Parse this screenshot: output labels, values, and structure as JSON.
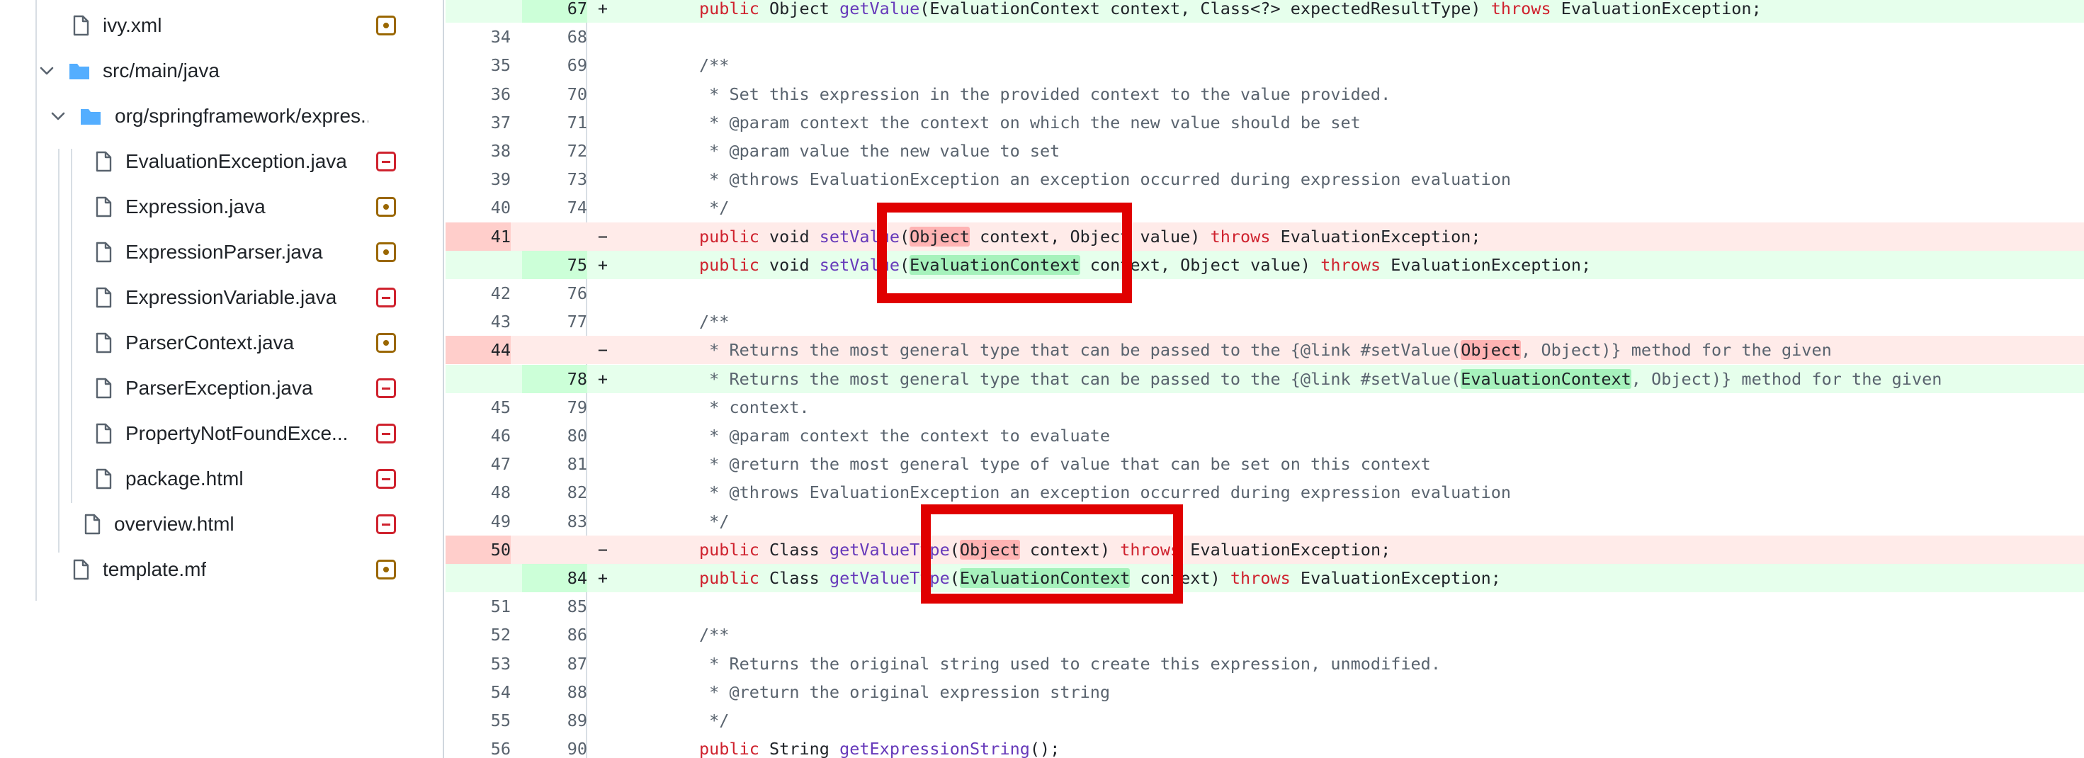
{
  "file_tree": {
    "items": [
      {
        "name": "ivy.xml",
        "status": "modified",
        "kind": "file"
      },
      {
        "name": "src/main/java",
        "kind": "folder"
      },
      {
        "name": "org/springframework/expres...",
        "kind": "folder"
      },
      {
        "name": "EvaluationException.java",
        "status": "deleted",
        "kind": "file"
      },
      {
        "name": "Expression.java",
        "status": "modified",
        "kind": "file"
      },
      {
        "name": "ExpressionParser.java",
        "status": "modified",
        "kind": "file"
      },
      {
        "name": "ExpressionVariable.java",
        "status": "deleted",
        "kind": "file"
      },
      {
        "name": "ParserContext.java",
        "status": "modified",
        "kind": "file"
      },
      {
        "name": "ParserException.java",
        "status": "deleted",
        "kind": "file"
      },
      {
        "name": "PropertyNotFoundExce...",
        "status": "deleted",
        "kind": "file"
      },
      {
        "name": "package.html",
        "status": "deleted",
        "kind": "file"
      },
      {
        "name": "overview.html",
        "status": "deleted",
        "kind": "file"
      },
      {
        "name": "template.mf",
        "status": "modified",
        "kind": "file"
      }
    ]
  },
  "diff": {
    "rows": [
      {
        "old": "",
        "new": "67",
        "type": "add",
        "sign": "+",
        "tokens": [
          [
            "kw",
            "public"
          ],
          [
            "t",
            " Object "
          ],
          [
            "fn",
            "getValue"
          ],
          [
            "t",
            "(EvaluationContext context, Class<?> expectedResultType) "
          ],
          [
            "kw",
            "throws"
          ],
          [
            "t",
            " EvaluationException;"
          ]
        ]
      },
      {
        "old": "34",
        "new": "68",
        "type": "ctx",
        "sign": "",
        "tokens": []
      },
      {
        "old": "35",
        "new": "69",
        "type": "ctx",
        "sign": "",
        "tokens": [
          [
            "cm",
            "/**"
          ]
        ]
      },
      {
        "old": "36",
        "new": "70",
        "type": "ctx",
        "sign": "",
        "tokens": [
          [
            "cm",
            " * Set this expression in the provided context to the value provided."
          ]
        ]
      },
      {
        "old": "37",
        "new": "71",
        "type": "ctx",
        "sign": "",
        "tokens": [
          [
            "cm",
            " * @param context the context on which the new value should be set"
          ]
        ]
      },
      {
        "old": "38",
        "new": "72",
        "type": "ctx",
        "sign": "",
        "tokens": [
          [
            "cm",
            " * @param value the new value to set"
          ]
        ]
      },
      {
        "old": "39",
        "new": "73",
        "type": "ctx",
        "sign": "",
        "tokens": [
          [
            "cm",
            " * @throws EvaluationException an exception occurred during expression evaluation"
          ]
        ]
      },
      {
        "old": "40",
        "new": "74",
        "type": "ctx",
        "sign": "",
        "tokens": [
          [
            "cm",
            " */"
          ]
        ]
      },
      {
        "old": "41",
        "new": "",
        "type": "del",
        "sign": "−",
        "tokens": [
          [
            "kw",
            "public"
          ],
          [
            "t",
            " void "
          ],
          [
            "fn",
            "setValue"
          ],
          [
            "t",
            "("
          ],
          [
            "hd",
            "Object"
          ],
          [
            "t",
            " context, Object value) "
          ],
          [
            "kw",
            "throws"
          ],
          [
            "t",
            " EvaluationException;"
          ]
        ]
      },
      {
        "old": "",
        "new": "75",
        "type": "add",
        "sign": "+",
        "tokens": [
          [
            "kw",
            "public"
          ],
          [
            "t",
            " void "
          ],
          [
            "fn",
            "setValue"
          ],
          [
            "t",
            "("
          ],
          [
            "ha",
            "EvaluationContext"
          ],
          [
            "t",
            " context, Object value) "
          ],
          [
            "kw",
            "throws"
          ],
          [
            "t",
            " EvaluationException;"
          ]
        ]
      },
      {
        "old": "42",
        "new": "76",
        "type": "ctx",
        "sign": "",
        "tokens": []
      },
      {
        "old": "43",
        "new": "77",
        "type": "ctx",
        "sign": "",
        "tokens": [
          [
            "cm",
            "/**"
          ]
        ]
      },
      {
        "old": "44",
        "new": "",
        "type": "del",
        "sign": "−",
        "tokens": [
          [
            "cm",
            " * Returns the most general type that can be passed to the {@link #setValue("
          ],
          [
            "hd",
            "Object"
          ],
          [
            "cm",
            ", Object)} method for the given"
          ]
        ]
      },
      {
        "old": "",
        "new": "78",
        "type": "add",
        "sign": "+",
        "tokens": [
          [
            "cm",
            " * Returns the most general type that can be passed to the {@link #setValue("
          ],
          [
            "ha",
            "EvaluationContext"
          ],
          [
            "cm",
            ", Object)} method for the given"
          ]
        ]
      },
      {
        "old": "45",
        "new": "79",
        "type": "ctx",
        "sign": "",
        "tokens": [
          [
            "cm",
            " * context."
          ]
        ]
      },
      {
        "old": "46",
        "new": "80",
        "type": "ctx",
        "sign": "",
        "tokens": [
          [
            "cm",
            " * @param context the context to evaluate"
          ]
        ]
      },
      {
        "old": "47",
        "new": "81",
        "type": "ctx",
        "sign": "",
        "tokens": [
          [
            "cm",
            " * @return the most general type of value that can be set on this context"
          ]
        ]
      },
      {
        "old": "48",
        "new": "82",
        "type": "ctx",
        "sign": "",
        "tokens": [
          [
            "cm",
            " * @throws EvaluationException an exception occurred during expression evaluation"
          ]
        ]
      },
      {
        "old": "49",
        "new": "83",
        "type": "ctx",
        "sign": "",
        "tokens": [
          [
            "cm",
            " */"
          ]
        ]
      },
      {
        "old": "50",
        "new": "",
        "type": "del",
        "sign": "−",
        "tokens": [
          [
            "kw",
            "public"
          ],
          [
            "t",
            " Class "
          ],
          [
            "fn",
            "getValueType"
          ],
          [
            "t",
            "("
          ],
          [
            "hd",
            "Object"
          ],
          [
            "t",
            " context) "
          ],
          [
            "kw",
            "throws"
          ],
          [
            "t",
            " EvaluationException;"
          ]
        ]
      },
      {
        "old": "",
        "new": "84",
        "type": "add",
        "sign": "+",
        "tokens": [
          [
            "kw",
            "public"
          ],
          [
            "t",
            " Class "
          ],
          [
            "fn",
            "getValueType"
          ],
          [
            "t",
            "("
          ],
          [
            "ha",
            "EvaluationContext"
          ],
          [
            "t",
            " context) "
          ],
          [
            "kw",
            "throws"
          ],
          [
            "t",
            " EvaluationException;"
          ]
        ]
      },
      {
        "old": "51",
        "new": "85",
        "type": "ctx",
        "sign": "",
        "tokens": []
      },
      {
        "old": "52",
        "new": "86",
        "type": "ctx",
        "sign": "",
        "tokens": [
          [
            "cm",
            "/**"
          ]
        ]
      },
      {
        "old": "53",
        "new": "87",
        "type": "ctx",
        "sign": "",
        "tokens": [
          [
            "cm",
            " * Returns the original string used to create this expression, unmodified."
          ]
        ]
      },
      {
        "old": "54",
        "new": "88",
        "type": "ctx",
        "sign": "",
        "tokens": [
          [
            "cm",
            " * @return the original expression string"
          ]
        ]
      },
      {
        "old": "55",
        "new": "89",
        "type": "ctx",
        "sign": "",
        "tokens": [
          [
            "cm",
            " */"
          ]
        ]
      },
      {
        "old": "56",
        "new": "90",
        "type": "ctx",
        "sign": "",
        "tokens": [
          [
            "kw",
            "public"
          ],
          [
            "t",
            " String "
          ],
          [
            "fn",
            "getExpressionString"
          ],
          [
            "t",
            "();"
          ]
        ]
      }
    ]
  },
  "colors": {
    "added_bg": "#e6ffec",
    "deleted_bg": "#ffebe9",
    "keyword": "#cf222e",
    "function": "#6639ba",
    "comment": "#59636e",
    "annotation_box": "#e00000",
    "folder_icon": "#54aeff"
  }
}
